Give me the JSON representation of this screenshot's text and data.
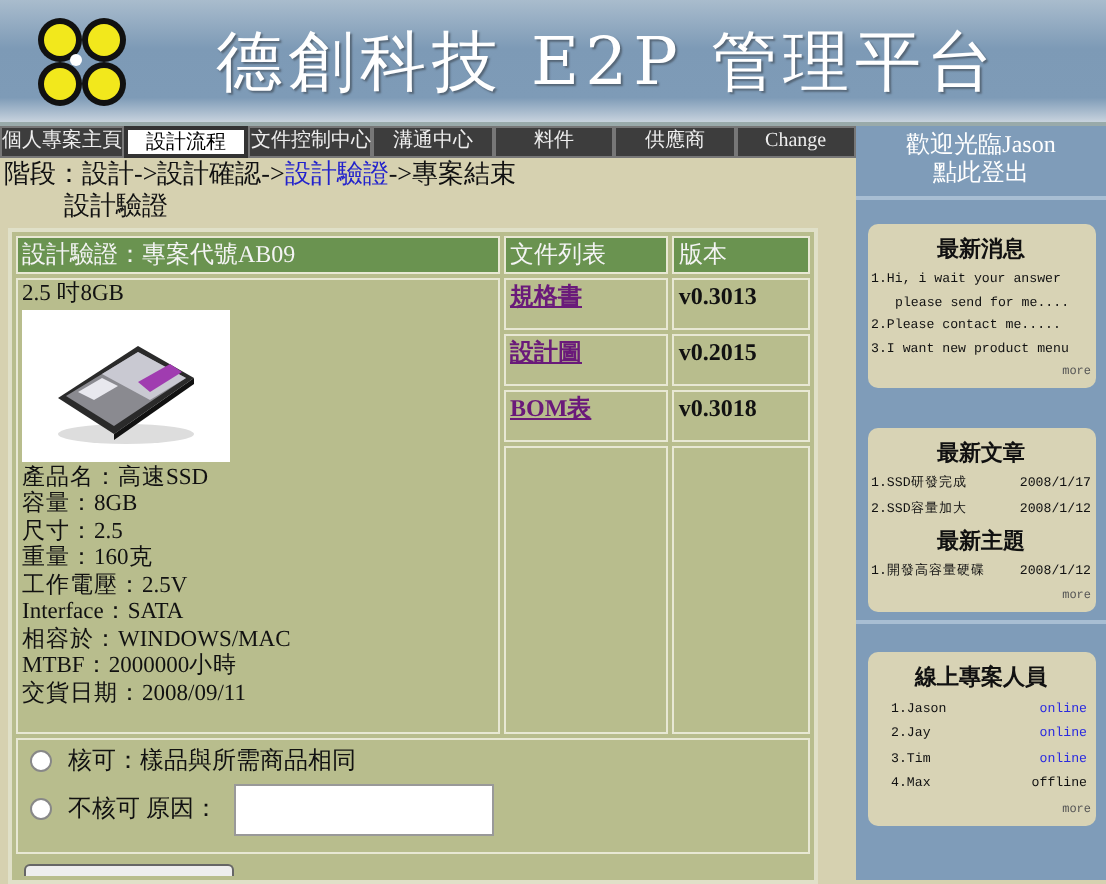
{
  "header": {
    "title": "德創科技 E2P 管理平台"
  },
  "nav": [
    {
      "label": "個人專案主頁",
      "selected": false
    },
    {
      "label": "設計流程",
      "selected": true
    },
    {
      "label": "文件控制中心",
      "selected": false
    },
    {
      "label": "溝通中心",
      "selected": false
    },
    {
      "label": "料件",
      "selected": false
    },
    {
      "label": "供應商",
      "selected": false
    },
    {
      "label": "Change",
      "selected": false
    }
  ],
  "breadcrumb": {
    "prefix": "階段：設計->設計確認->",
    "current": "設計驗證",
    "suffix": "->專案結束"
  },
  "stage_title": "設計驗證",
  "product": {
    "title": "設計驗證：專案代號AB09",
    "name": "2.5 吋8GB",
    "specs": [
      "產品名：高速SSD",
      "容量：8GB",
      "尺寸：2.5",
      "重量：160克",
      "工作電壓：2.5V",
      "Interface：SATA",
      "相容於：WINDOWS/MAC",
      "MTBF：2000000小時",
      "交貨日期：2008/09/11"
    ]
  },
  "documents": {
    "columns": [
      "文件列表",
      "版本"
    ],
    "rows": [
      {
        "name": "規格書",
        "version": "v0.3013"
      },
      {
        "name": "設計圖",
        "version": "v0.2015"
      },
      {
        "name": "BOM表",
        "version": "v0.3018"
      }
    ]
  },
  "approval": {
    "options": [
      {
        "label": "核可：樣品與所需商品相同",
        "selected": false,
        "kind": "plain"
      },
      {
        "label": "不核可 原因：",
        "selected": false,
        "kind": "reason"
      }
    ]
  },
  "sidebar": {
    "welcome": "歡迎光臨Jason",
    "logout": "點此登出",
    "news": {
      "title": "最新消息",
      "items": [
        "1.Hi, i wait your answer",
        "please send for me....",
        "2.Please contact me.....",
        "3.I want new product menu"
      ],
      "more": "more"
    },
    "articles": {
      "title": "最新文章",
      "items": [
        {
          "text": "1.SSD研發完成",
          "date": "2008/1/17"
        },
        {
          "text": "2.SSD容量加大",
          "date": "2008/1/12"
        }
      ],
      "topics_title": "最新主題",
      "topics": [
        {
          "text": "1.開發高容量硬碟",
          "date": "2008/1/12"
        }
      ],
      "more": "more"
    },
    "online": {
      "title": "線上專案人員",
      "members": [
        {
          "name": "1.Jason",
          "status": "online",
          "online": true
        },
        {
          "name": "2.Jay",
          "status": "online",
          "online": true
        },
        {
          "name": "3.Tim",
          "status": "online",
          "online": true
        },
        {
          "name": "4.Max",
          "status": "offline",
          "online": false
        }
      ],
      "more": "more"
    }
  }
}
